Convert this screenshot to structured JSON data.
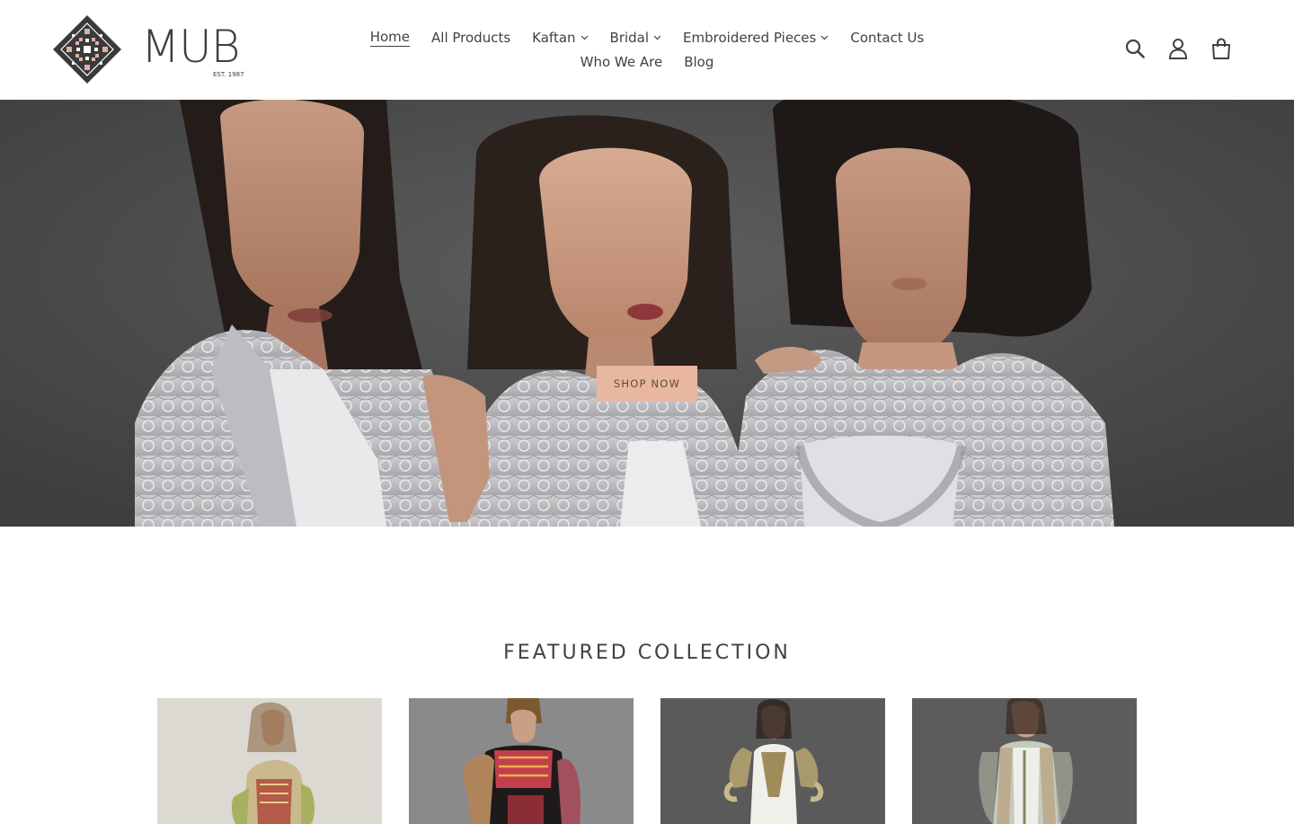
{
  "brand": {
    "name": "MUB",
    "tagline": "EST. 1987"
  },
  "nav": {
    "row1": [
      {
        "label": "Home",
        "active": true,
        "dropdown": false
      },
      {
        "label": "All Products",
        "active": false,
        "dropdown": false
      },
      {
        "label": "Kaftan",
        "active": false,
        "dropdown": true
      },
      {
        "label": "Bridal",
        "active": false,
        "dropdown": true
      },
      {
        "label": "Embroidered Pieces",
        "active": false,
        "dropdown": true
      },
      {
        "label": "Contact Us",
        "active": false,
        "dropdown": false
      }
    ],
    "row2": [
      {
        "label": "Who We Are",
        "active": false,
        "dropdown": false
      },
      {
        "label": "Blog",
        "active": false,
        "dropdown": false
      }
    ]
  },
  "header_icons": [
    "search-icon",
    "account-icon",
    "cart-icon"
  ],
  "hero": {
    "cta": "SHOP NOW"
  },
  "featured": {
    "title": "FEATURED COLLECTION",
    "products": [
      {
        "image": "product-image-1"
      },
      {
        "image": "product-image-2"
      },
      {
        "image": "product-image-3"
      },
      {
        "image": "product-image-4"
      }
    ]
  },
  "colors": {
    "text": "#3d4246",
    "cta_bg": "#e9b79f",
    "hero_bg": "#4f4f4f",
    "logo_accent": "#b58a7a"
  }
}
